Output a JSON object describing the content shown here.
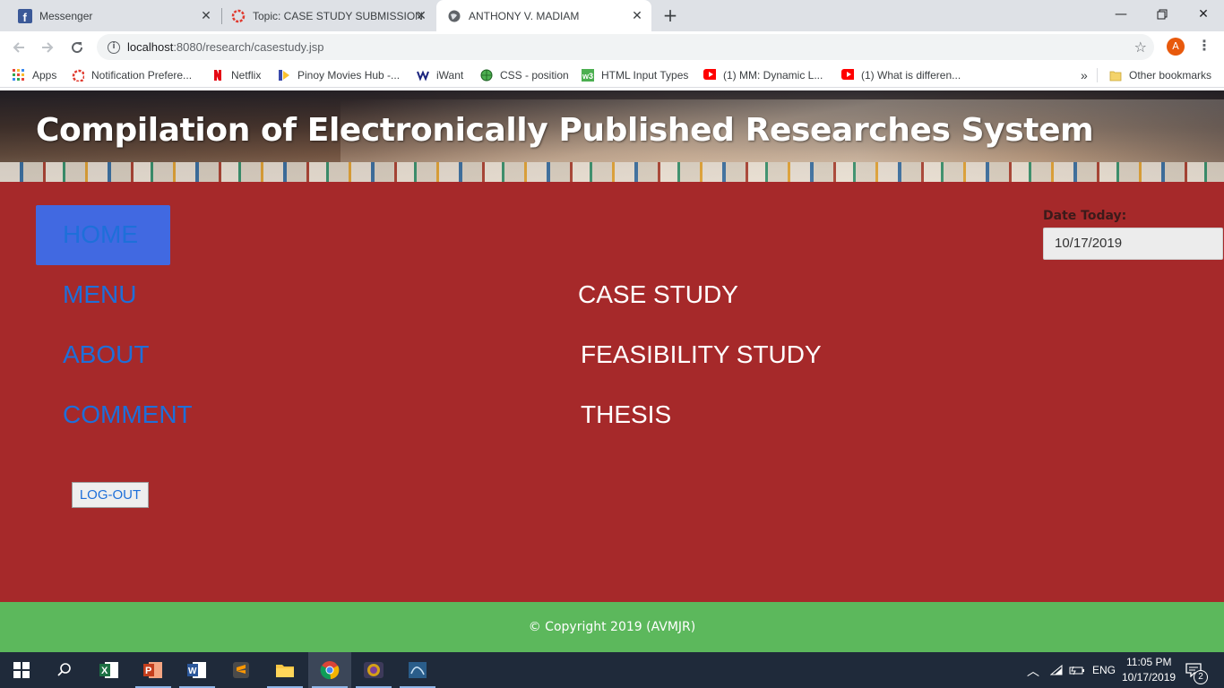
{
  "browser": {
    "tabs": [
      {
        "title": "Messenger",
        "icon": "facebook-icon"
      },
      {
        "title": "Topic: CASE STUDY SUBMISSION",
        "icon": "ring-icon"
      },
      {
        "title": "ANTHONY V. MADIAM",
        "icon": "globe-icon",
        "active": true
      }
    ],
    "url_host": "localhost",
    "url_rest": ":8080/research/casestudy.jsp",
    "profile_initial": "A",
    "bookmarks": [
      {
        "label": "Apps",
        "icon": "apps-grid-icon"
      },
      {
        "label": "Notification Prefere...",
        "icon": "ring-icon"
      },
      {
        "label": "Netflix",
        "icon": "netflix-icon"
      },
      {
        "label": "Pinoy Movies Hub -...",
        "icon": "pinoy-movies-icon"
      },
      {
        "label": "iWant",
        "icon": "iwant-icon"
      },
      {
        "label": "CSS - position",
        "icon": "globe-icon"
      },
      {
        "label": "HTML Input Types",
        "icon": "w3schools-icon"
      },
      {
        "label": "(1) MM: Dynamic L...",
        "icon": "youtube-icon"
      },
      {
        "label": "(1) What is differen...",
        "icon": "youtube-icon"
      }
    ],
    "bookmarks_overflow": "»",
    "other_bookmarks": "Other bookmarks"
  },
  "page": {
    "banner_title": "Compilation of Electronically Published Researches System",
    "nav": {
      "home": "HOME",
      "menu": "MENU",
      "about": "ABOUT",
      "comment": "COMMENT"
    },
    "research": {
      "case_study": "CASE STUDY",
      "feasibility_study": "FEASIBILITY STUDY",
      "thesis": "THESIS"
    },
    "date_label": "Date Today:",
    "date_value": "10/17/2019",
    "logout": "LOG-OUT",
    "footer": "© Copyright 2019 (AVMJR)"
  },
  "taskbar": {
    "language": "ENG",
    "time": "11:05 PM",
    "date": "10/17/2019",
    "notifications": "2"
  },
  "colors": {
    "content_bg": "#a6292a",
    "home_bg": "#4169e1",
    "nav_link": "#1e6fd9",
    "footer_bg": "#5cb85c"
  }
}
